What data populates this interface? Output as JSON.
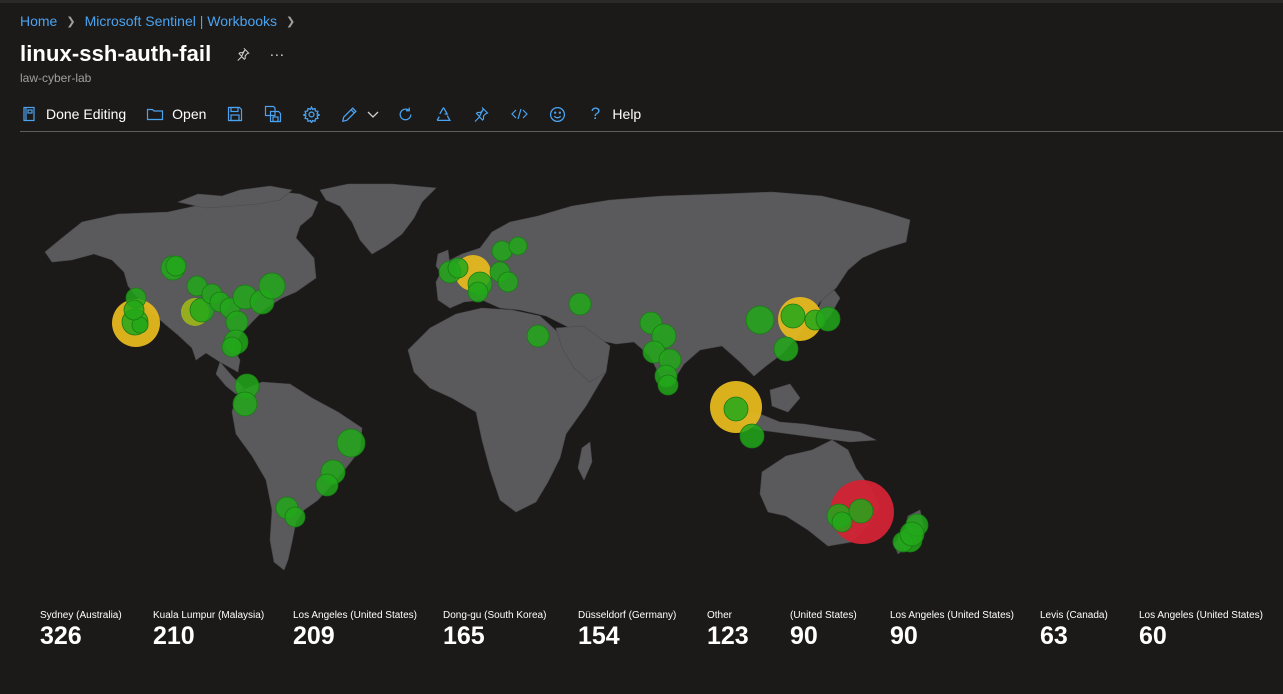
{
  "breadcrumb": {
    "home": "Home",
    "parent": "Microsoft Sentinel | Workbooks"
  },
  "title": "linux-ssh-auth-fail",
  "subtitle": "law-cyber-lab",
  "toolbar": {
    "done_editing": "Done Editing",
    "open": "Open",
    "help": "Help"
  },
  "colors": {
    "accent": "#4aa3f0",
    "background": "#1b1a19",
    "land": "#5a5a5d",
    "low": "#22a81a",
    "mid": "#e6b81e",
    "high": "#d32334"
  },
  "tiles": [
    {
      "label": "Sydney (Australia)",
      "value": "326"
    },
    {
      "label": "Kuala Lumpur (Malaysia)",
      "value": "210"
    },
    {
      "label": "Los Angeles (United States)",
      "value": "209"
    },
    {
      "label": "Dong-gu (South Korea)",
      "value": "165"
    },
    {
      "label": "Düsseldorf (Germany)",
      "value": "154"
    },
    {
      "label": "Other",
      "value": "123"
    },
    {
      "label": "(United States)",
      "value": "90"
    },
    {
      "label": "Los Angeles (United States)",
      "value": "90"
    },
    {
      "label": "Levis (Canada)",
      "value": "63"
    },
    {
      "label": "Los Angeles (United States)",
      "value": "60"
    }
  ]
}
